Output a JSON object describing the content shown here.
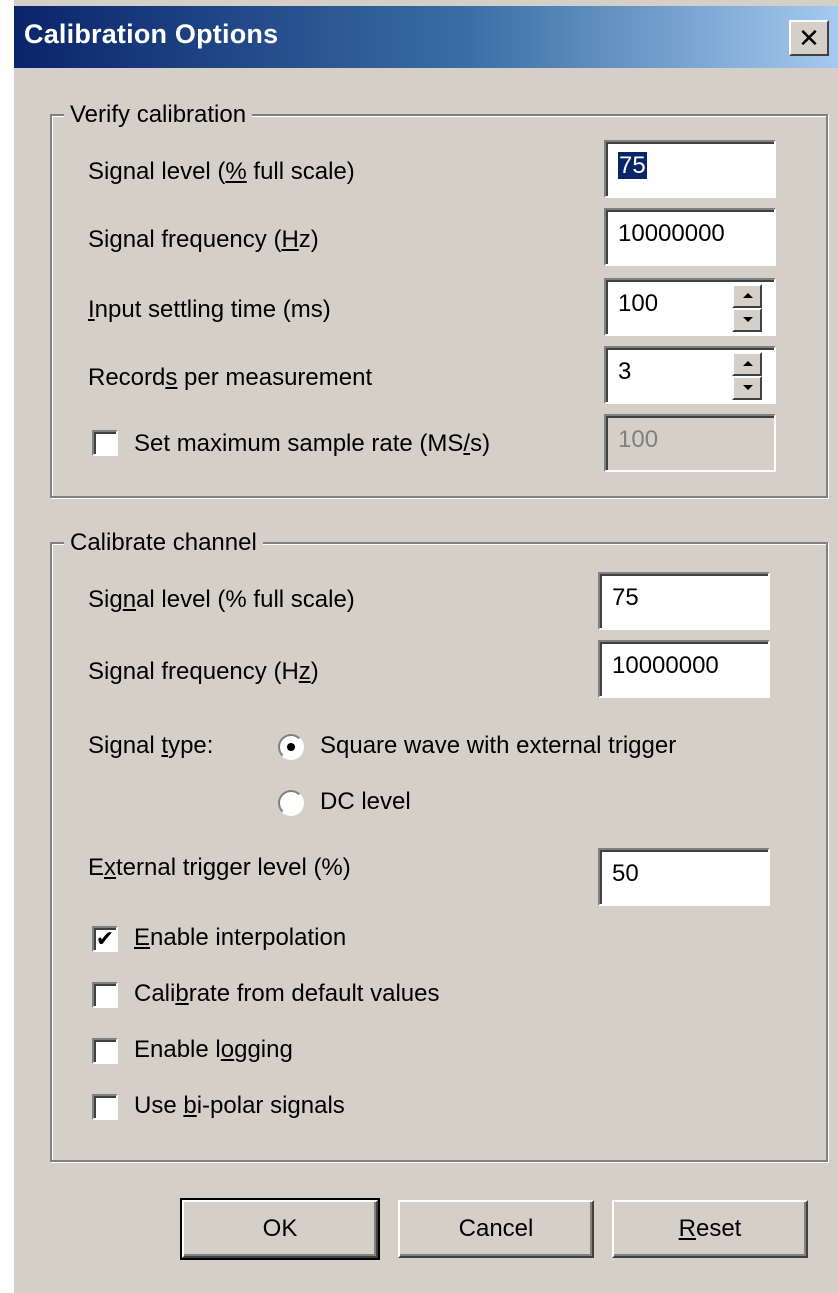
{
  "window": {
    "title": "Calibration Options",
    "close_glyph": "✕",
    "title_gradient": [
      "#0a246a",
      "#a6caf0"
    ],
    "face_color": "#d4d0c8"
  },
  "verify": {
    "legend": "Verify calibration",
    "signal_level": {
      "label_pre": "Signal level (",
      "label_mn": "%",
      "label_post": " full scale)",
      "value": "75",
      "selected": true
    },
    "signal_frequency": {
      "label_pre": "Signal frequency (",
      "label_mn": "H",
      "label_post": "z)",
      "value": "10000000"
    },
    "settling_time": {
      "label_pre": "",
      "label_mn": "I",
      "label_post": "nput settling time (ms)",
      "value": "100"
    },
    "records": {
      "label_pre": "Record",
      "label_mn": "s",
      "label_post": " per measurement",
      "value": "3"
    },
    "max_sample_rate": {
      "label_pre": "Set maximum sample rate (MS",
      "label_mn": "/",
      "label_post": "s)",
      "value": "100",
      "checked": false,
      "enabled": false
    }
  },
  "calibrate": {
    "legend": "Calibrate channel",
    "signal_level": {
      "label_pre": "Sig",
      "label_mn": "n",
      "label_post": "al level (% full scale)",
      "value": "75"
    },
    "signal_frequency": {
      "label_pre": "Signal frequency (H",
      "label_mn": "z",
      "label_post": ")",
      "value": "10000000"
    },
    "signal_type": {
      "label_pre": "Signal ",
      "label_mn": "t",
      "label_post": "ype:",
      "options": [
        "Square wave with external trigger",
        "DC level"
      ],
      "selected": "Square wave with external trigger"
    },
    "trigger_level": {
      "label_pre": "E",
      "label_mn": "x",
      "label_post": "ternal trigger level  (%)",
      "value": "50"
    },
    "interpolation": {
      "label_pre": "",
      "label_mn": "E",
      "label_post": "nable interpolation",
      "checked": true
    },
    "default_values": {
      "label_pre": "Cali",
      "label_mn": "b",
      "label_post": "rate from default values",
      "checked": false
    },
    "logging": {
      "label_pre": "Enable l",
      "label_mn": "o",
      "label_post": "gging",
      "checked": false
    },
    "bipolar": {
      "label_pre": "Use ",
      "label_mn": "b",
      "label_post": "i-polar signals",
      "checked": false
    }
  },
  "buttons": {
    "ok": {
      "label": "OK"
    },
    "cancel": {
      "label": "Cancel"
    },
    "reset": {
      "label_pre": "",
      "label_mn": "R",
      "label_post": "eset"
    }
  },
  "glyphs": {
    "check": "✔"
  }
}
